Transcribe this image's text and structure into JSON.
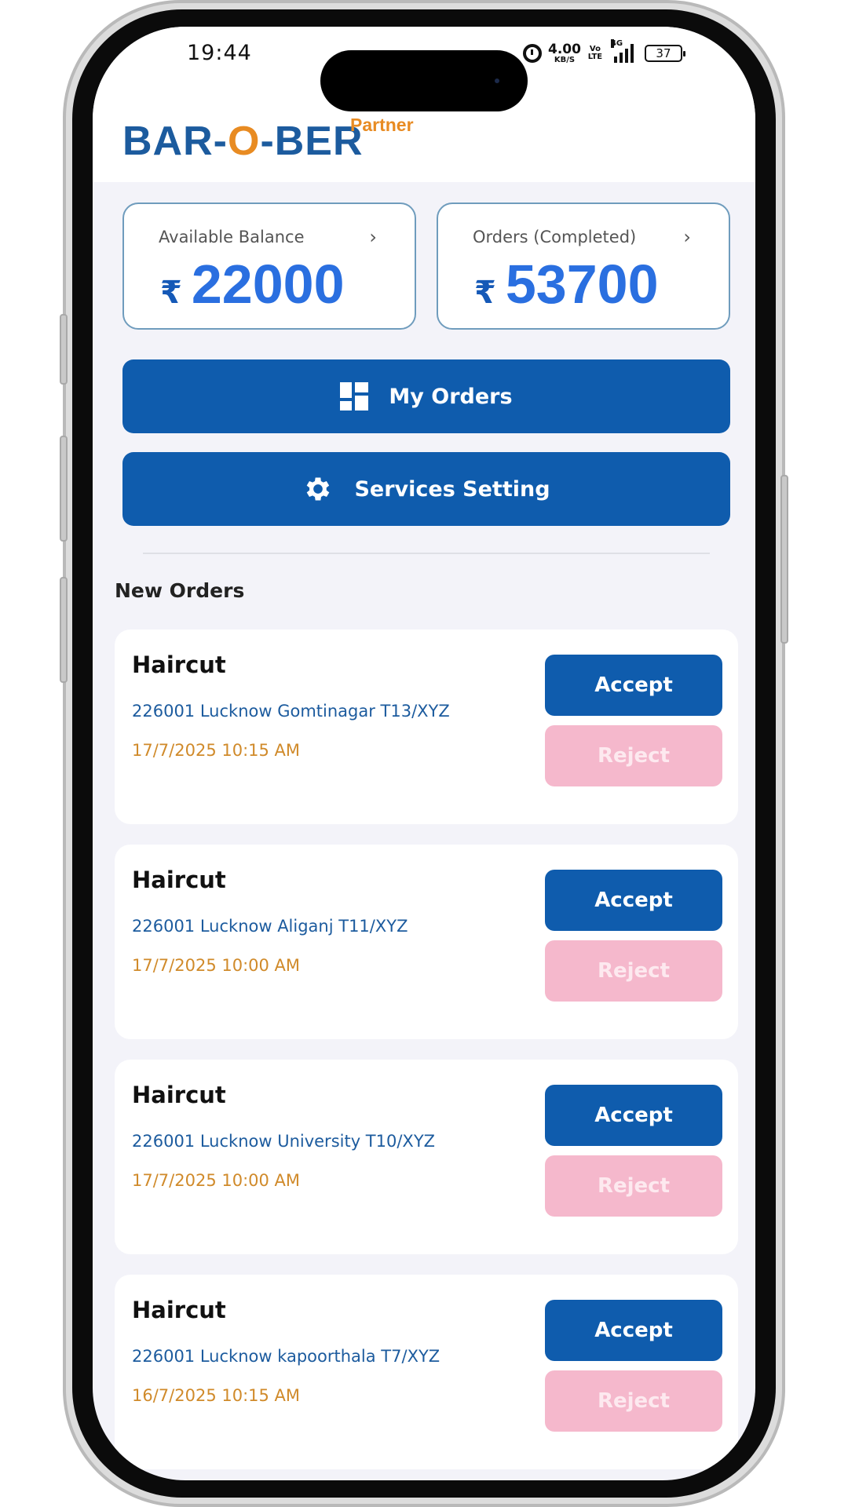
{
  "status_bar": {
    "time": "19:44",
    "net_speed": "4.00",
    "net_unit": "KB/S",
    "volte": "Vo LTE",
    "network": "4G",
    "battery": "37"
  },
  "header": {
    "logo_part1": "BAR-",
    "logo_o": "O",
    "logo_part2": "-BER",
    "logo_sub": "Partner"
  },
  "stats": {
    "balance": {
      "label": "Available Balance",
      "currency": "₹",
      "value": "22000"
    },
    "orders": {
      "label": "Orders (Completed)",
      "currency": "₹",
      "value": "53700"
    }
  },
  "actions": {
    "my_orders": "My Orders",
    "services_setting": "Services Setting"
  },
  "section_title": "New Orders",
  "orders": [
    {
      "service": "Haircut",
      "address": "226001 Lucknow Gomtinagar T13/XYZ",
      "time": "17/7/2025 10:15 AM",
      "accept": "Accept",
      "reject": "Reject"
    },
    {
      "service": "Haircut",
      "address": "226001 Lucknow Aliganj T11/XYZ",
      "time": "17/7/2025 10:00 AM",
      "accept": "Accept",
      "reject": "Reject"
    },
    {
      "service": "Haircut",
      "address": "226001 Lucknow University T10/XYZ",
      "time": "17/7/2025 10:00 AM",
      "accept": "Accept",
      "reject": "Reject"
    },
    {
      "service": "Haircut",
      "address": "226001 Lucknow kapoorthala T7/XYZ",
      "time": "16/7/2025 10:15 AM",
      "accept": "Accept",
      "reject": "Reject"
    }
  ],
  "colors": {
    "primary": "#0f5cad",
    "accent": "#e88b22",
    "reject": "#f5b8cc",
    "address": "#1c5b9e",
    "time": "#d08a2a"
  }
}
